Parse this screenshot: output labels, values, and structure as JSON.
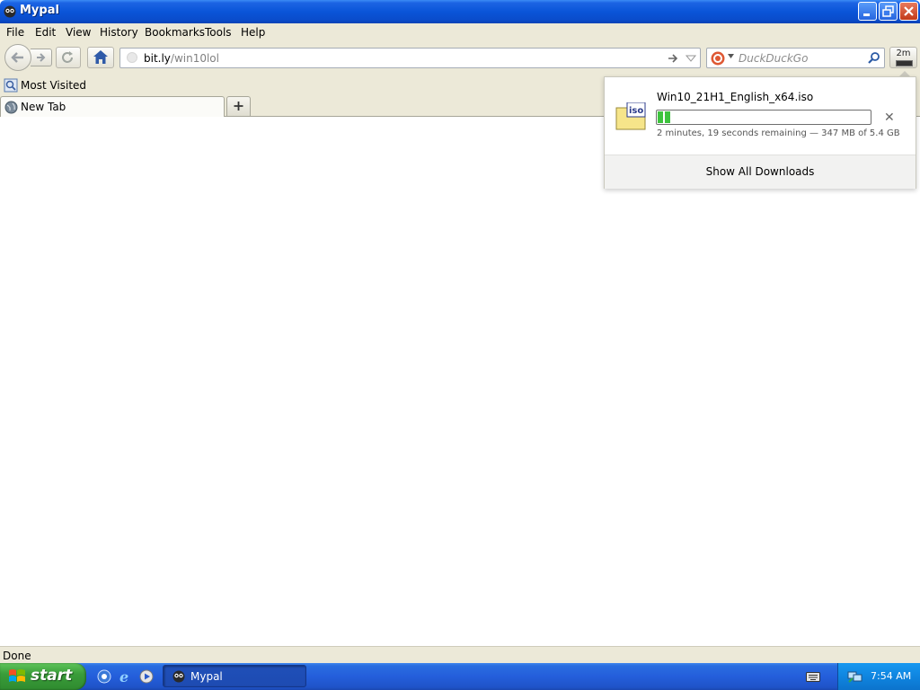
{
  "window": {
    "title": "Mypal"
  },
  "menu": [
    "File",
    "Edit",
    "View",
    "History",
    "Bookmarks",
    "Tools",
    "Help"
  ],
  "navigation": {
    "url_host": "bit.ly",
    "url_path": "/win10lol",
    "search_placeholder": "DuckDuckGo",
    "download_button_label": "2m"
  },
  "bookmarks_toolbar": {
    "item": "Most Visited"
  },
  "tabs": [
    {
      "label": "New Tab",
      "active": true
    }
  ],
  "downloads_panel": {
    "filename": "Win10_21H1_English_x64.iso",
    "file_icon_label": "iso",
    "progress_fraction": 0.063,
    "status": "2 minutes, 19 seconds remaining — 347 MB of 5.4 GB",
    "show_all": "Show All Downloads"
  },
  "status_bar": {
    "text": "Done"
  },
  "taskbar": {
    "start_label": "start",
    "quick_launch": [
      "windows-media-icon",
      "internet-explorer-icon",
      "media-player-icon"
    ],
    "tasks": [
      {
        "label": "Mypal"
      }
    ],
    "clock": "7:54 AM"
  },
  "colors": {
    "titlebar_blue": "#0a55d8",
    "progress_green": "#3ec33e",
    "chrome_beige": "#ece9d8",
    "start_green": "#3a9d3a"
  }
}
